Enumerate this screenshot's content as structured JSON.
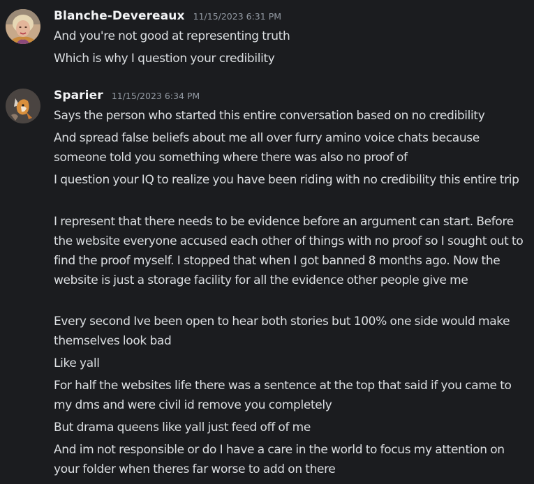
{
  "messages": [
    {
      "author": "Blanche-Devereaux",
      "timestamp": "11/15/2023 6:31 PM",
      "avatar_icon": "user-avatar-woman-portrait",
      "lines": [
        "And you're not good at representing truth",
        "Which is why I question your credibility"
      ]
    },
    {
      "author": "Sparier",
      "timestamp": "11/15/2023 6:34 PM",
      "avatar_icon": "user-avatar-fox-character",
      "lines": [
        "Says the person who started this entire conversation based on no credibility",
        "And spread false beliefs about me all over furry amino voice chats because someone told you something where there was also no proof of",
        "I question your IQ to realize you have been riding with no credibility this entire trip",
        "I represent that there needs to be evidence before an argument can start. Before the website everyone accused each other of things with no proof so I sought out to find the proof myself. I stopped that when I got banned 8 months ago. Now the website is just a storage facility for all the evidence other people give me",
        "Every second Ive been open to hear both stories but 100% one side would make themselves look bad",
        "Like yall",
        "For half the websites life there was a sentence at the top that said if you came to my dms and were civil id remove you completely",
        "But drama queens like yall just feed off of me",
        "And im not responsible or do I have a care in the world to focus my attention on your folder when theres far worse to add on there"
      ]
    }
  ]
}
